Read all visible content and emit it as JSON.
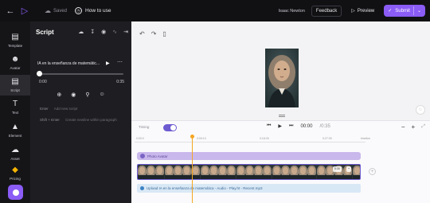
{
  "topbar": {
    "saved_label": "Saved",
    "howto_label": "How to use",
    "user_name": "Isaac Newton",
    "feedback_label": "Feedback",
    "preview_label": "Preview",
    "submit_label": "Submit"
  },
  "nav": {
    "items": [
      {
        "label": "Template",
        "icon": "template-icon"
      },
      {
        "label": "Avatar",
        "icon": "avatar-icon"
      },
      {
        "label": "Script",
        "icon": "script-icon"
      },
      {
        "label": "Text",
        "icon": "text-icon"
      },
      {
        "label": "Element",
        "icon": "element-icon"
      },
      {
        "label": "Asset",
        "icon": "asset-icon"
      },
      {
        "label": "Pricing",
        "icon": "diamond-icon"
      }
    ],
    "active": "Script"
  },
  "panel": {
    "title": "Script",
    "audio_title": "IA en la enseñanza de matemátic...",
    "time_start": "0:00",
    "time_end": "0:35",
    "hint1_key": "Enter",
    "hint1_text": "Add new script",
    "hint2_key": "Shift + Enter",
    "hint2_text": "Create newline within paragraph"
  },
  "timeline": {
    "timing_label": "Timing",
    "current_time": "00:00",
    "duration": "/0:35",
    "ruler": [
      "0:00:0",
      "0:09:13",
      "0:18:26",
      "0:27:39",
      "timeline"
    ],
    "avatar_track_label": "Photo Avatar",
    "audio_track_label": "Upload IA en la enseñanza de matemática - Audio - Play.ht - Recent.mp3",
    "frame_tags": [
      "0:30",
      "+"
    ]
  },
  "colors": {
    "accent": "#8b5cf6",
    "playhead": "#f5a623",
    "avatar_track": "#c9b8ec",
    "audio_track": "#d9e8f5"
  }
}
